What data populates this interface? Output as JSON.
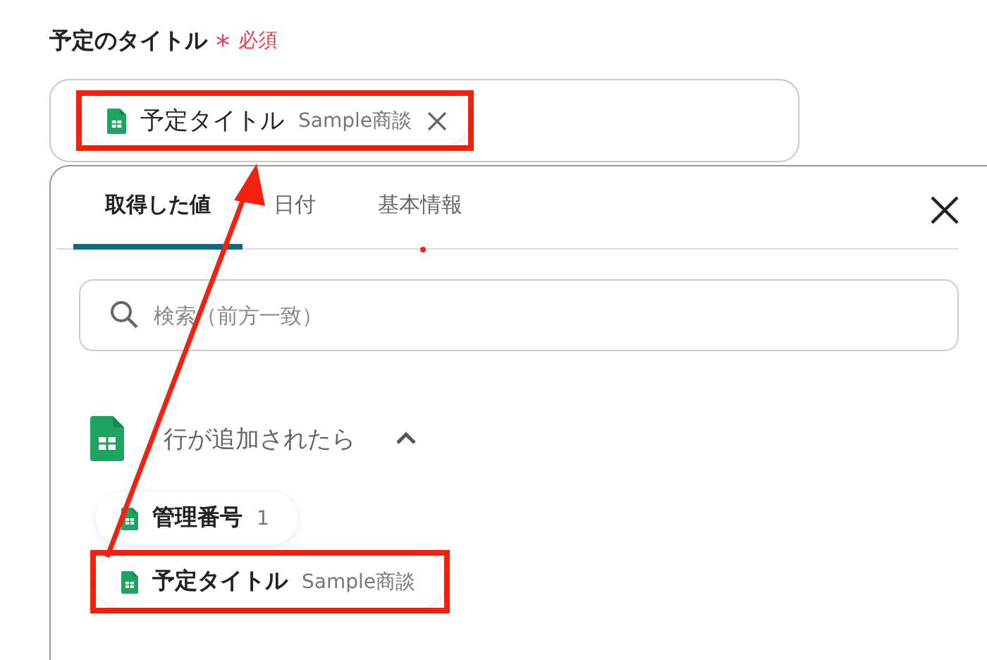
{
  "field": {
    "label": "予定のタイトル",
    "required_mark": "*",
    "required_text": "必須",
    "chip": {
      "name": "予定タイトル",
      "value": "Sample商談",
      "highlighted": true
    }
  },
  "panel": {
    "tabs": [
      {
        "label": "取得した値",
        "selected": true,
        "dot": false
      },
      {
        "label": "日付",
        "selected": false,
        "dot": false
      },
      {
        "label": "基本情報",
        "selected": false,
        "dot": true
      }
    ],
    "search": {
      "placeholder": "検索（前方一致）"
    },
    "group": {
      "title": "行が追加されたら",
      "expanded": true,
      "items": [
        {
          "name": "管理番号",
          "value": "1",
          "highlighted": false
        },
        {
          "name": "予定タイトル",
          "value": "Sample商談",
          "highlighted": true
        }
      ]
    }
  }
}
